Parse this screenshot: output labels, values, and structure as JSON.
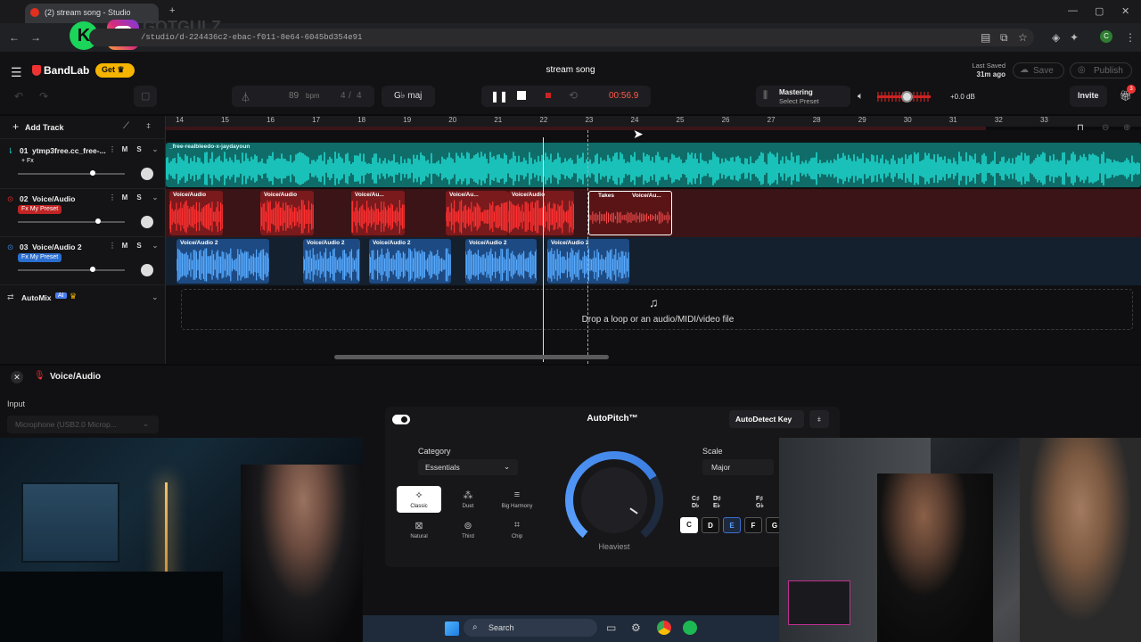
{
  "browser": {
    "tab_title": "(2) stream song - Studio",
    "watermark": "GOTGULZ",
    "url": "/studio/d-224436c2-ebac-f011-8e64-6045bd354e91",
    "new_tab": "+",
    "minimize": "—",
    "maximize": "▢",
    "close": "✕",
    "profile_initial": "C"
  },
  "header": {
    "brand": "BandLab",
    "get_label": "Get",
    "project_title": "stream song",
    "last_saved_label": "Last Saved",
    "last_saved_value": "31m ago",
    "save_label": "Save",
    "publish_label": "Publish",
    "invite_label": "Invite",
    "gift_count": "3"
  },
  "transport": {
    "bpm": "89",
    "bpm_unit": "bpm",
    "time_sig_top": "4",
    "time_sig_bottom": "4",
    "key": "G♭ maj",
    "time": "00:56.9",
    "mastering_label": "Mastering",
    "mastering_preset": "Select Preset",
    "volume_db": "+0.0 dB",
    "volume_level": 0.55
  },
  "toolbar": {
    "add_track": "Add Track"
  },
  "ruler": {
    "bars": [
      "14",
      "15",
      "16",
      "17",
      "18",
      "19",
      "20",
      "21",
      "22",
      "23",
      "24",
      "25",
      "26",
      "27",
      "28",
      "29",
      "30",
      "31",
      "32",
      "33"
    ]
  },
  "tracks": [
    {
      "num": "01",
      "name": "ytmp3free.cc_free-...",
      "preset": "+ Fx",
      "color": "#19d9d0",
      "mute": "M",
      "solo": "S",
      "volume": 0.7
    },
    {
      "num": "02",
      "name": "Voice/Audio",
      "preset": "Fx My Preset",
      "color": "#e52929",
      "mute": "M",
      "solo": "S",
      "volume": 0.75
    },
    {
      "num": "03",
      "name": "Voice/Audio 2",
      "preset": "Fx My Preset",
      "color": "#3b8ee8",
      "mute": "M",
      "solo": "S",
      "volume": 0.7
    }
  ],
  "automix": {
    "label": "AutoMix",
    "badge": "AI"
  },
  "lane1": {
    "clip_label": "_free-realbleedo-x-jaydayoun"
  },
  "lane2": {
    "clips": [
      "Voice/Audio",
      "Voice/Audio",
      "Voice/Au...",
      "Voice/Au...",
      "Voice/Audio"
    ],
    "takes_label": "Takes",
    "takes_clip": "Voice/Au..."
  },
  "lane3": {
    "clips": [
      "Voice/Audio 2",
      "Voice/Audio 2",
      "Voice/Audio 2",
      "Voice/Audio 2",
      "Voice/Audio 2"
    ]
  },
  "dropzone": {
    "text": "Drop a loop or an audio/MIDI/video file"
  },
  "panel": {
    "title": "Voice/Audio",
    "input_label": "Input",
    "input_value": "Microphone (USB2.0 Microp...",
    "autopitch": {
      "title": "AutoPitch™",
      "autodetect_label": "AutoDetect Key",
      "category_label": "Category",
      "category_value": "Essentials",
      "options": [
        "Classic",
        "Duet",
        "Big Harmony",
        "Natural",
        "Third",
        "Chip"
      ],
      "dial_label": "Heaviest",
      "scale_label": "Scale",
      "scale_value": "Major",
      "sharps": [
        "C♯ D♭",
        "D♯ E♭",
        "F♯ G♭"
      ],
      "keys": [
        "C",
        "D",
        "E",
        "F",
        "G"
      ]
    }
  },
  "taskbar": {
    "search_label": "Search"
  }
}
